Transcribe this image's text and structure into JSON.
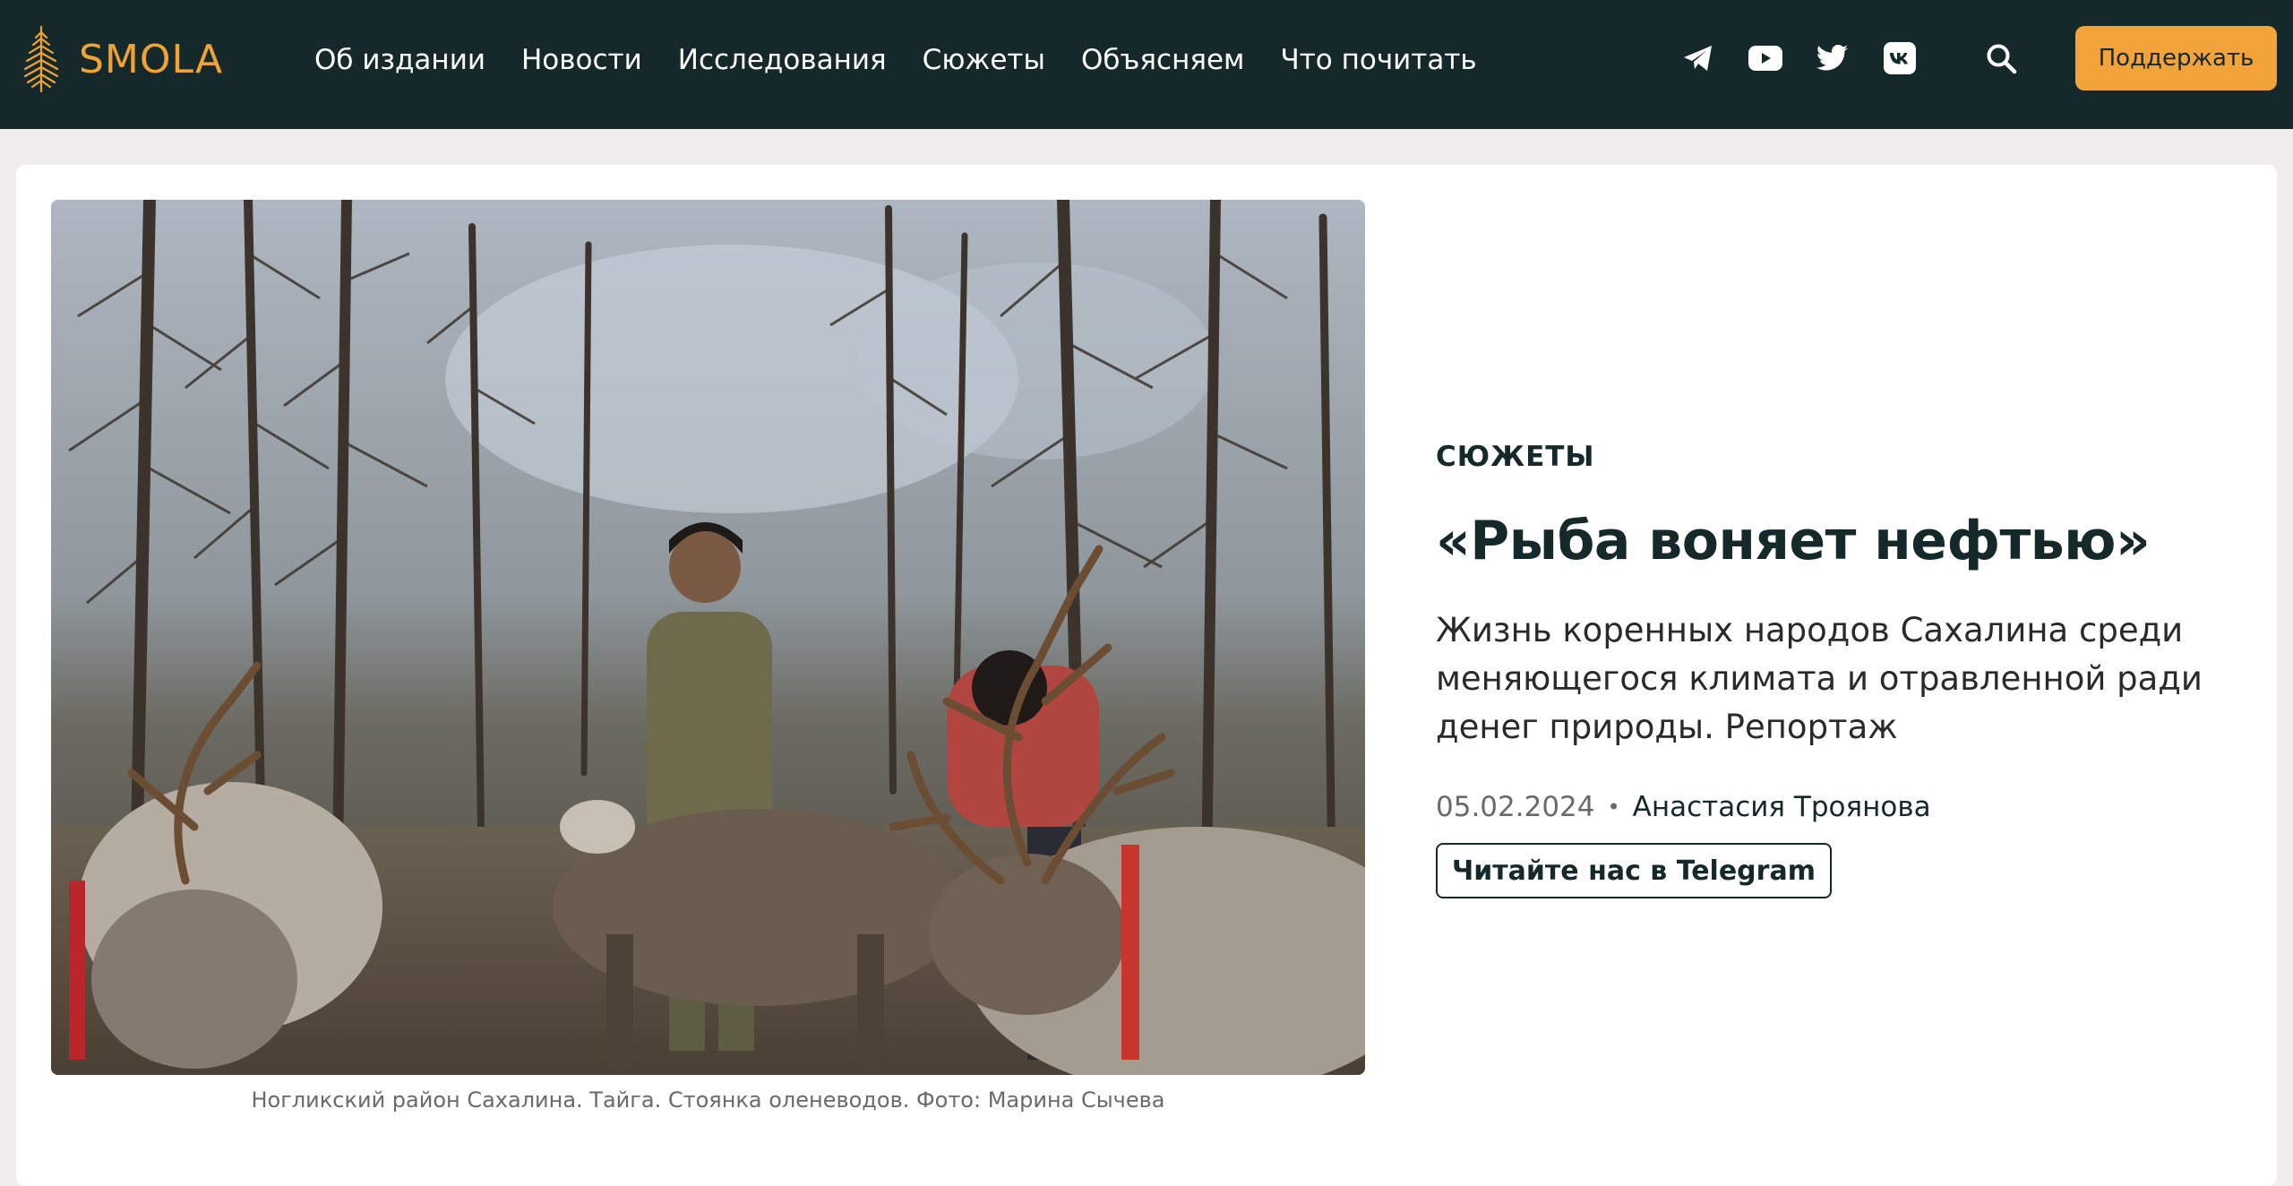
{
  "header": {
    "logo_text": "SMOLA",
    "nav": [
      {
        "label": "Об издании"
      },
      {
        "label": "Новости"
      },
      {
        "label": "Исследования"
      },
      {
        "label": "Сюжеты"
      },
      {
        "label": "Объясняем"
      },
      {
        "label": "Что почитать"
      }
    ],
    "socials": [
      "telegram-icon",
      "youtube-icon",
      "twitter-icon",
      "vk-icon"
    ],
    "search_icon": "search-icon",
    "support_label": "Поддержать"
  },
  "article": {
    "rubric": "СЮЖЕТЫ",
    "title": "«Рыба воняет нефтью»",
    "lead": "Жизнь коренных народов Сахалина среди меняющегося климата и отравленной ради денег природы. Репортаж",
    "date": "05.02.2024",
    "separator": "•",
    "author": "Анастасия Троянова",
    "telegram_cta": "Читайте нас в Telegram",
    "photo_caption": "Ногликский район Сахалина. Тайга. Стоянка оленеводов. Фото: Марина Сычева"
  },
  "colors": {
    "header_bg": "#15292a",
    "accent": "#f2a43a",
    "page_bg": "#efeded",
    "text_dark": "#15292a"
  }
}
